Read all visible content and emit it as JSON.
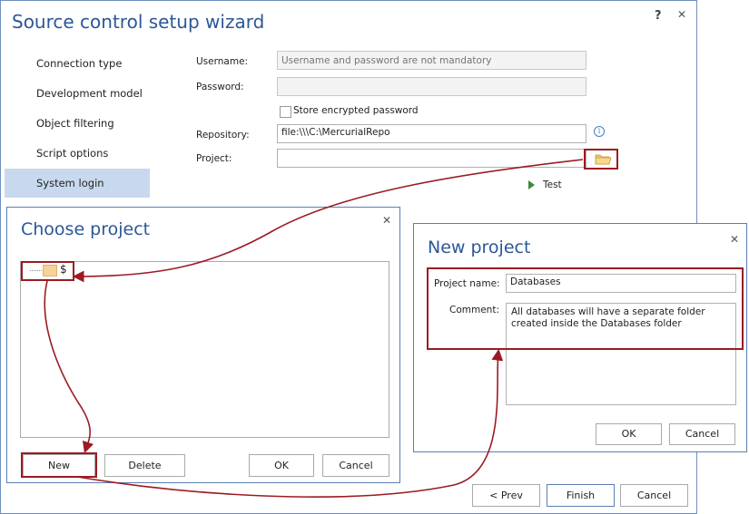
{
  "wizard": {
    "title": "Source control setup wizard",
    "help": "?",
    "close": "✕",
    "nav": [
      "Connection type",
      "Development model",
      "Object filtering",
      "Script options",
      "System login"
    ],
    "selected_nav": 4,
    "username_label": "Username:",
    "username_placeholder": "Username and password are not mandatory",
    "password_label": "Password:",
    "store_password_label": "Store encrypted password",
    "repository_label": "Repository:",
    "repository_value": "file:\\\\\\C:\\MercurialRepo",
    "project_label": "Project:",
    "project_value": "",
    "test_label": "Test",
    "prev_label": "< Prev",
    "finish_label": "Finish",
    "cancel_label": "Cancel"
  },
  "choose_project": {
    "title": "Choose project",
    "close": "✕",
    "root_node": "$",
    "new_label": "New",
    "delete_label": "Delete",
    "ok_label": "OK",
    "cancel_label": "Cancel"
  },
  "new_project": {
    "title": "New project",
    "close": "✕",
    "name_label": "Project name:",
    "name_value": "Databases",
    "comment_label": "Comment:",
    "comment_value": "All databases will have a separate folder created inside the Databases folder",
    "ok_label": "OK",
    "cancel_label": "Cancel"
  },
  "colors": {
    "accent": "#2b5797",
    "highlight": "#9b1b22",
    "selected_nav": "#c8d9ef",
    "border": "#5b7fb4"
  }
}
